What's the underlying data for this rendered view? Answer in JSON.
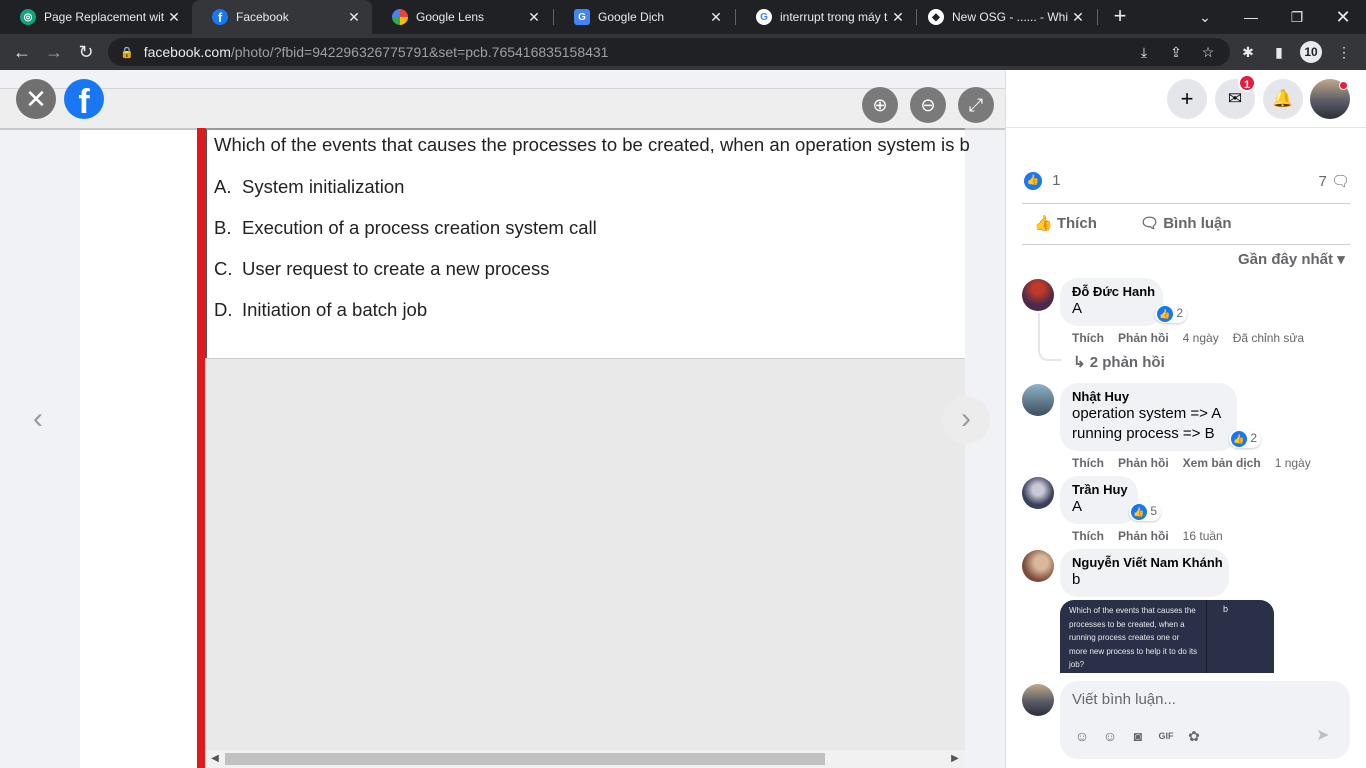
{
  "browser": {
    "tabs": [
      {
        "title": "Page Replacement wit",
        "icon": "chatgpt-icon",
        "color": "#10a37f",
        "glyph": "◎"
      },
      {
        "title": "Facebook",
        "icon": "facebook-icon",
        "color": "#1877f2",
        "glyph": "f"
      },
      {
        "title": "Google Lens",
        "icon": "google-lens-icon",
        "color": "#4285f4",
        "glyph": "◉"
      },
      {
        "title": "Google Dịch",
        "icon": "google-translate-icon",
        "color": "#4285f4",
        "glyph": "G"
      },
      {
        "title": "interrupt trong máy tí",
        "icon": "google-icon",
        "color": "#ffffff",
        "glyph": "G"
      },
      {
        "title": "New OSG - ...... - Whic",
        "icon": "osg-icon",
        "color": "#ffffff",
        "glyph": "◆"
      }
    ],
    "url_host": "facebook.com",
    "url_path": "/photo/?fbid=942296326775791&set=pcb.765416835158431",
    "profile_count": "10"
  },
  "photo": {
    "question": "Which of the events that causes the processes to be created, when an operation system is b",
    "options": [
      {
        "letter": "A.",
        "text": "System initialization"
      },
      {
        "letter": "B.",
        "text": "Execution of a process creation system call"
      },
      {
        "letter": "C.",
        "text": "User request to create a new process"
      },
      {
        "letter": "D.",
        "text": "Initiation of a batch job"
      }
    ]
  },
  "panel": {
    "messenger_badge": "1",
    "like_count": "1",
    "comment_count": "7",
    "like_label": "Thích",
    "comment_label": "Bình luận",
    "sort_label": "Gần đây nhất",
    "comments": [
      {
        "name": "Đỗ Đức Hanh",
        "text": "A",
        "reactions": "2",
        "like": "Thích",
        "reply": "Phản hồi",
        "time": "4 ngày",
        "extra": "Đã chỉnh sửa",
        "avatar_color": "#7a2a3a"
      },
      {
        "name": "Nhật Huy",
        "text": "operation system => A",
        "text2": "running process => B",
        "reactions": "2",
        "like": "Thích",
        "reply": "Phản hồi",
        "extra": "Xem bản dịch",
        "time": "1 ngày",
        "avatar_color": "#4a6a80"
      },
      {
        "name": "Trần Huy",
        "text": "A",
        "reactions": "5",
        "like": "Thích",
        "reply": "Phản hồi",
        "time": "16 tuần",
        "avatar_color": "#3a3f5a"
      },
      {
        "name": "Nguyễn Viết Nam Khánh",
        "text": "b",
        "avatar_color": "#8a6a5a"
      }
    ],
    "replies_label": "2 phản hồi",
    "attachment_text": "Which of the events that causes the processes to be created, when a running process creates one or more new process to help it to do its job?",
    "attachment_answer": "b",
    "composer_placeholder": "Viết bình luận..."
  }
}
